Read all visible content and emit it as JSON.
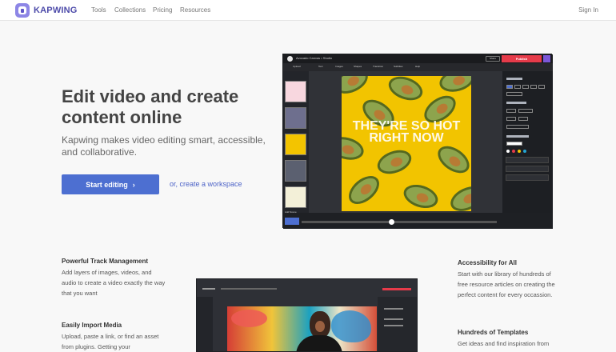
{
  "nav": {
    "brand": "KAPWING",
    "links": [
      "Tools",
      "Collections",
      "Pricing",
      "Resources"
    ],
    "sign_in": "Sign In"
  },
  "hero": {
    "title": "Edit video and create content online",
    "subtitle": "Kapwing makes video editing smart, accessible, and collaborative.",
    "start_button": "Start editing",
    "start_icon": "chevron-right-icon",
    "workspace_link": "or, create a workspace"
  },
  "editor_preview": {
    "project_title": "Avocado Canvas • Studio",
    "share": "Share",
    "publish": "Publish",
    "tools": [
      "Upload",
      "Text",
      "Images",
      "Shapes",
      "Transition",
      "Subtitles",
      "Help"
    ],
    "overlay_text": "THEY'RE SO HOT RIGHT NOW",
    "add_scene": "Add Scene",
    "accent_color": "#e63b4a"
  },
  "features_left": [
    {
      "title": "Powerful Track Management",
      "text": "Add layers of images, videos, and audio to create a video exactly the way that you want"
    },
    {
      "title": "Easily Import Media",
      "text": "Upload, paste a link, or find an asset from plugins. Getting your"
    }
  ],
  "features_right": [
    {
      "title": "Accessibility for All",
      "text": "Start with our library of hundreds of free resource articles on creating the perfect content for every occassion."
    },
    {
      "title": "Hundreds of Templates",
      "text": "Get ideas and find inspiration from"
    }
  ]
}
